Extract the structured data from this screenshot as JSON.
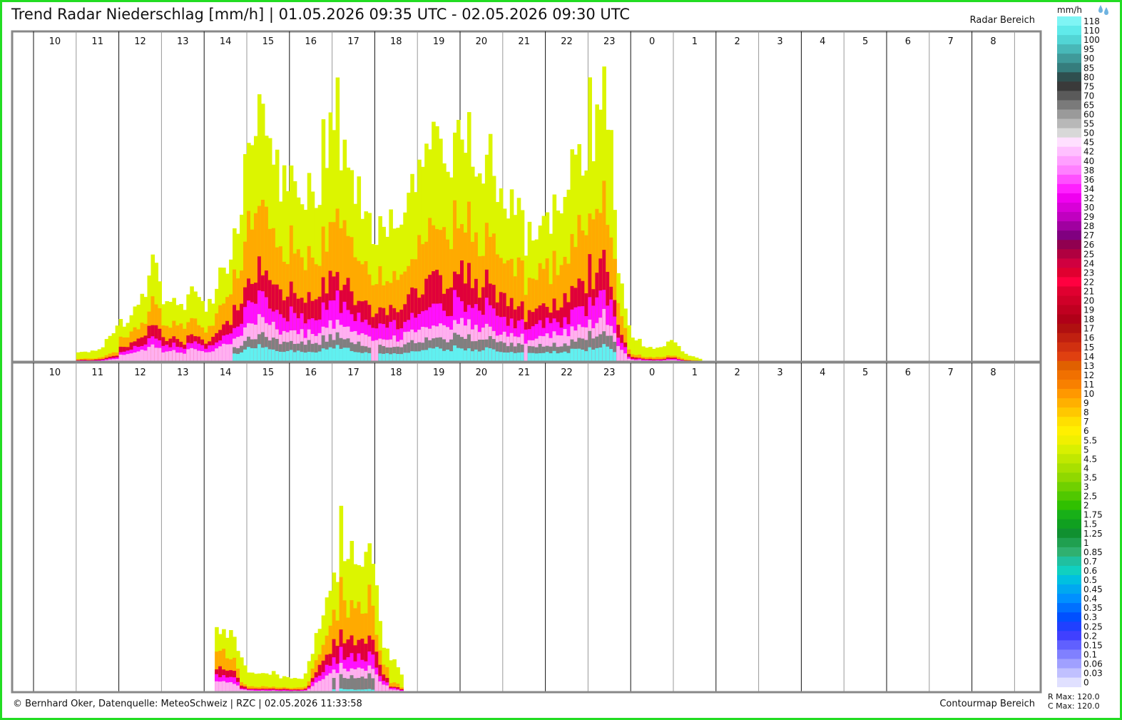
{
  "header": {
    "title": "Trend Radar Niederschlag [mm/h] | 01.05.2026 09:35 UTC - 02.05.2026 09:30 UTC",
    "right_label": "Radar Bereich"
  },
  "footer": {
    "left": "© Bernhard Oker, Datenquelle: MeteoSchweiz | RZC | 02.05.2026 11:33:58",
    "right": "Contourmap Bereich",
    "rmax": "R Max: 120.0",
    "cmax": "C Max: 120.0"
  },
  "legend": {
    "unit": "mm/h",
    "icon": "raindrop-icon",
    "levels": [
      "118",
      "110",
      "100",
      "95",
      "90",
      "85",
      "80",
      "75",
      "70",
      "65",
      "60",
      "55",
      "50",
      "45",
      "42",
      "40",
      "38",
      "36",
      "34",
      "32",
      "30",
      "29",
      "28",
      "27",
      "26",
      "25",
      "24",
      "23",
      "22",
      "21",
      "20",
      "19",
      "18",
      "17",
      "16",
      "15",
      "14",
      "13",
      "12",
      "11",
      "10",
      "9",
      "8",
      "7",
      "6",
      "5.5",
      "5",
      "4.5",
      "4",
      "3.5",
      "3",
      "2.5",
      "2",
      "1.75",
      "1.5",
      "1.25",
      "1",
      "0.85",
      "0.7",
      "0.6",
      "0.5",
      "0.45",
      "0.4",
      "0.35",
      "0.3",
      "0.25",
      "0.2",
      "0.15",
      "0.1",
      "0.06",
      "0.03",
      "0"
    ],
    "colors": [
      "#7ff5f5",
      "#60eaea",
      "#52d5d5",
      "#48b8b8",
      "#3f9a9a",
      "#357d7d",
      "#2f4f4f",
      "#3a3a3a",
      "#5a5a5a",
      "#7a7a7a",
      "#9a9a9a",
      "#b8b8b8",
      "#d8d8d8",
      "#ffe0ff",
      "#ffc0ff",
      "#ffa0ff",
      "#ff80ff",
      "#ff50ff",
      "#ff20ff",
      "#f000f0",
      "#d800d8",
      "#c000c0",
      "#a000a0",
      "#800080",
      "#900050",
      "#b00040",
      "#d00040",
      "#e00030",
      "#ff0040",
      "#e00030",
      "#d00028",
      "#c00020",
      "#b00018",
      "#b01010",
      "#c02010",
      "#d03010",
      "#e04010",
      "#e06000",
      "#f07000",
      "#f88000",
      "#ff9800",
      "#ffb000",
      "#ffc800",
      "#ffe000",
      "#fff000",
      "#f0f000",
      "#d8f000",
      "#c0e800",
      "#a8e000",
      "#90d800",
      "#70d000",
      "#50c800",
      "#30c000",
      "#18b018",
      "#10a020",
      "#109030",
      "#20a050",
      "#30b070",
      "#20c0a0",
      "#10d0c0",
      "#00c0e0",
      "#00a8f0",
      "#0090ff",
      "#0070ff",
      "#0050ff",
      "#2040ff",
      "#4040ff",
      "#6060ff",
      "#8080ff",
      "#a0a0ff",
      "#c0c0ff",
      "#e0e0ff"
    ]
  },
  "chart_data": [
    {
      "type": "bar",
      "panel": "top",
      "x_hours": [
        "10",
        "11",
        "12",
        "13",
        "14",
        "15",
        "16",
        "17",
        "18",
        "19",
        "20",
        "21",
        "22",
        "23",
        "0",
        "1",
        "2",
        "3",
        "4",
        "5",
        "6",
        "7",
        "8"
      ],
      "series_levels": [
        "yellow",
        "orange",
        "red",
        "magenta",
        "lightpink",
        "gray",
        "cyan"
      ],
      "bins": [
        [
          0,
          0,
          0,
          0,
          0,
          0,
          0
        ],
        [
          0,
          0,
          0,
          0,
          0,
          0,
          0
        ],
        [
          0,
          0,
          0,
          0,
          0,
          0,
          0
        ],
        [
          0,
          0,
          0,
          0,
          0,
          0,
          0
        ],
        [
          0,
          0,
          0,
          0,
          0,
          0,
          0
        ],
        [
          0,
          0,
          0,
          0,
          0,
          0,
          0
        ],
        [
          0,
          0,
          0,
          0,
          0,
          0,
          0
        ],
        [
          0,
          0,
          0,
          0,
          0,
          0,
          0
        ],
        [
          0,
          0,
          0,
          0,
          0,
          0,
          0
        ],
        [
          0,
          0,
          0,
          0,
          0,
          0,
          0
        ],
        [
          0,
          0,
          0,
          0,
          0,
          0,
          0
        ],
        [
          0,
          0,
          0,
          0,
          0,
          0,
          0
        ],
        [
          0,
          0,
          0,
          0,
          0,
          0,
          0
        ],
        [
          0,
          0,
          0,
          0,
          0,
          0,
          0
        ],
        [
          0,
          0,
          0,
          0,
          0,
          0,
          0
        ],
        [
          0,
          0,
          0,
          0,
          0,
          0,
          0
        ],
        [
          0,
          0,
          0,
          0,
          0,
          0,
          0
        ],
        [
          0,
          0,
          0,
          0,
          0,
          0,
          0
        ],
        [
          0,
          0,
          0,
          0,
          0,
          0,
          0
        ],
        [
          0,
          0,
          0,
          0,
          0,
          0,
          0
        ],
        [
          0,
          0,
          0,
          0,
          0,
          0,
          0
        ],
        [
          0,
          0,
          0,
          0,
          0,
          0,
          0
        ],
        [
          0,
          0,
          0,
          0,
          0,
          0,
          0
        ],
        [
          0,
          0,
          0,
          0,
          0,
          0,
          0
        ]
      ],
      "envelope": [
        [
          11.0,
          0.03
        ],
        [
          11.5,
          0.04
        ],
        [
          12.0,
          0.13
        ],
        [
          12.5,
          0.2
        ],
        [
          12.75,
          0.32
        ],
        [
          13.0,
          0.22
        ],
        [
          13.5,
          0.18
        ],
        [
          13.75,
          0.25
        ],
        [
          14.0,
          0.16
        ],
        [
          14.5,
          0.35
        ],
        [
          14.75,
          0.5
        ],
        [
          15.0,
          0.75
        ],
        [
          15.2,
          0.85
        ],
        [
          15.4,
          0.8
        ],
        [
          15.8,
          0.62
        ],
        [
          16.0,
          0.58
        ],
        [
          16.3,
          0.48
        ],
        [
          16.6,
          0.6
        ],
        [
          16.9,
          0.7
        ],
        [
          17.2,
          0.75
        ],
        [
          17.5,
          0.55
        ],
        [
          17.8,
          0.48
        ],
        [
          18.2,
          0.4
        ],
        [
          18.5,
          0.45
        ],
        [
          19.0,
          0.6
        ],
        [
          19.5,
          0.68
        ],
        [
          19.8,
          0.73
        ],
        [
          20.2,
          0.7
        ],
        [
          20.5,
          0.65
        ],
        [
          20.8,
          0.6
        ],
        [
          21.2,
          0.5
        ],
        [
          21.6,
          0.4
        ],
        [
          22.0,
          0.48
        ],
        [
          22.3,
          0.53
        ],
        [
          22.6,
          0.6
        ],
        [
          22.8,
          0.68
        ],
        [
          23.0,
          0.75
        ],
        [
          23.2,
          0.86
        ],
        [
          23.4,
          0.82
        ],
        [
          23.6,
          0.45
        ],
        [
          23.8,
          0.18
        ],
        [
          24.0,
          0.08
        ],
        [
          24.3,
          0.05
        ],
        [
          24.6,
          0.04
        ],
        [
          24.9,
          0.08
        ],
        [
          25.3,
          0.02
        ],
        [
          25.6,
          0.01
        ]
      ],
      "ylim": [
        0,
        1
      ]
    },
    {
      "type": "bar",
      "panel": "bottom",
      "x_hours": [
        "10",
        "11",
        "12",
        "13",
        "14",
        "15",
        "16",
        "17",
        "18",
        "19",
        "20",
        "21",
        "22",
        "23",
        "0",
        "1",
        "2",
        "3",
        "4",
        "5",
        "6",
        "7",
        "8"
      ],
      "envelope": [
        [
          14.2,
          0.26
        ],
        [
          14.6,
          0.18
        ],
        [
          15.0,
          0.06
        ],
        [
          16.3,
          0.05
        ],
        [
          16.6,
          0.18
        ],
        [
          16.8,
          0.28
        ],
        [
          17.0,
          0.38
        ],
        [
          17.2,
          0.52
        ],
        [
          17.4,
          0.48
        ],
        [
          17.6,
          0.4
        ],
        [
          17.8,
          0.52
        ],
        [
          18.2,
          0.12
        ],
        [
          18.6,
          0.06
        ]
      ],
      "ylim": [
        0,
        1
      ]
    }
  ]
}
